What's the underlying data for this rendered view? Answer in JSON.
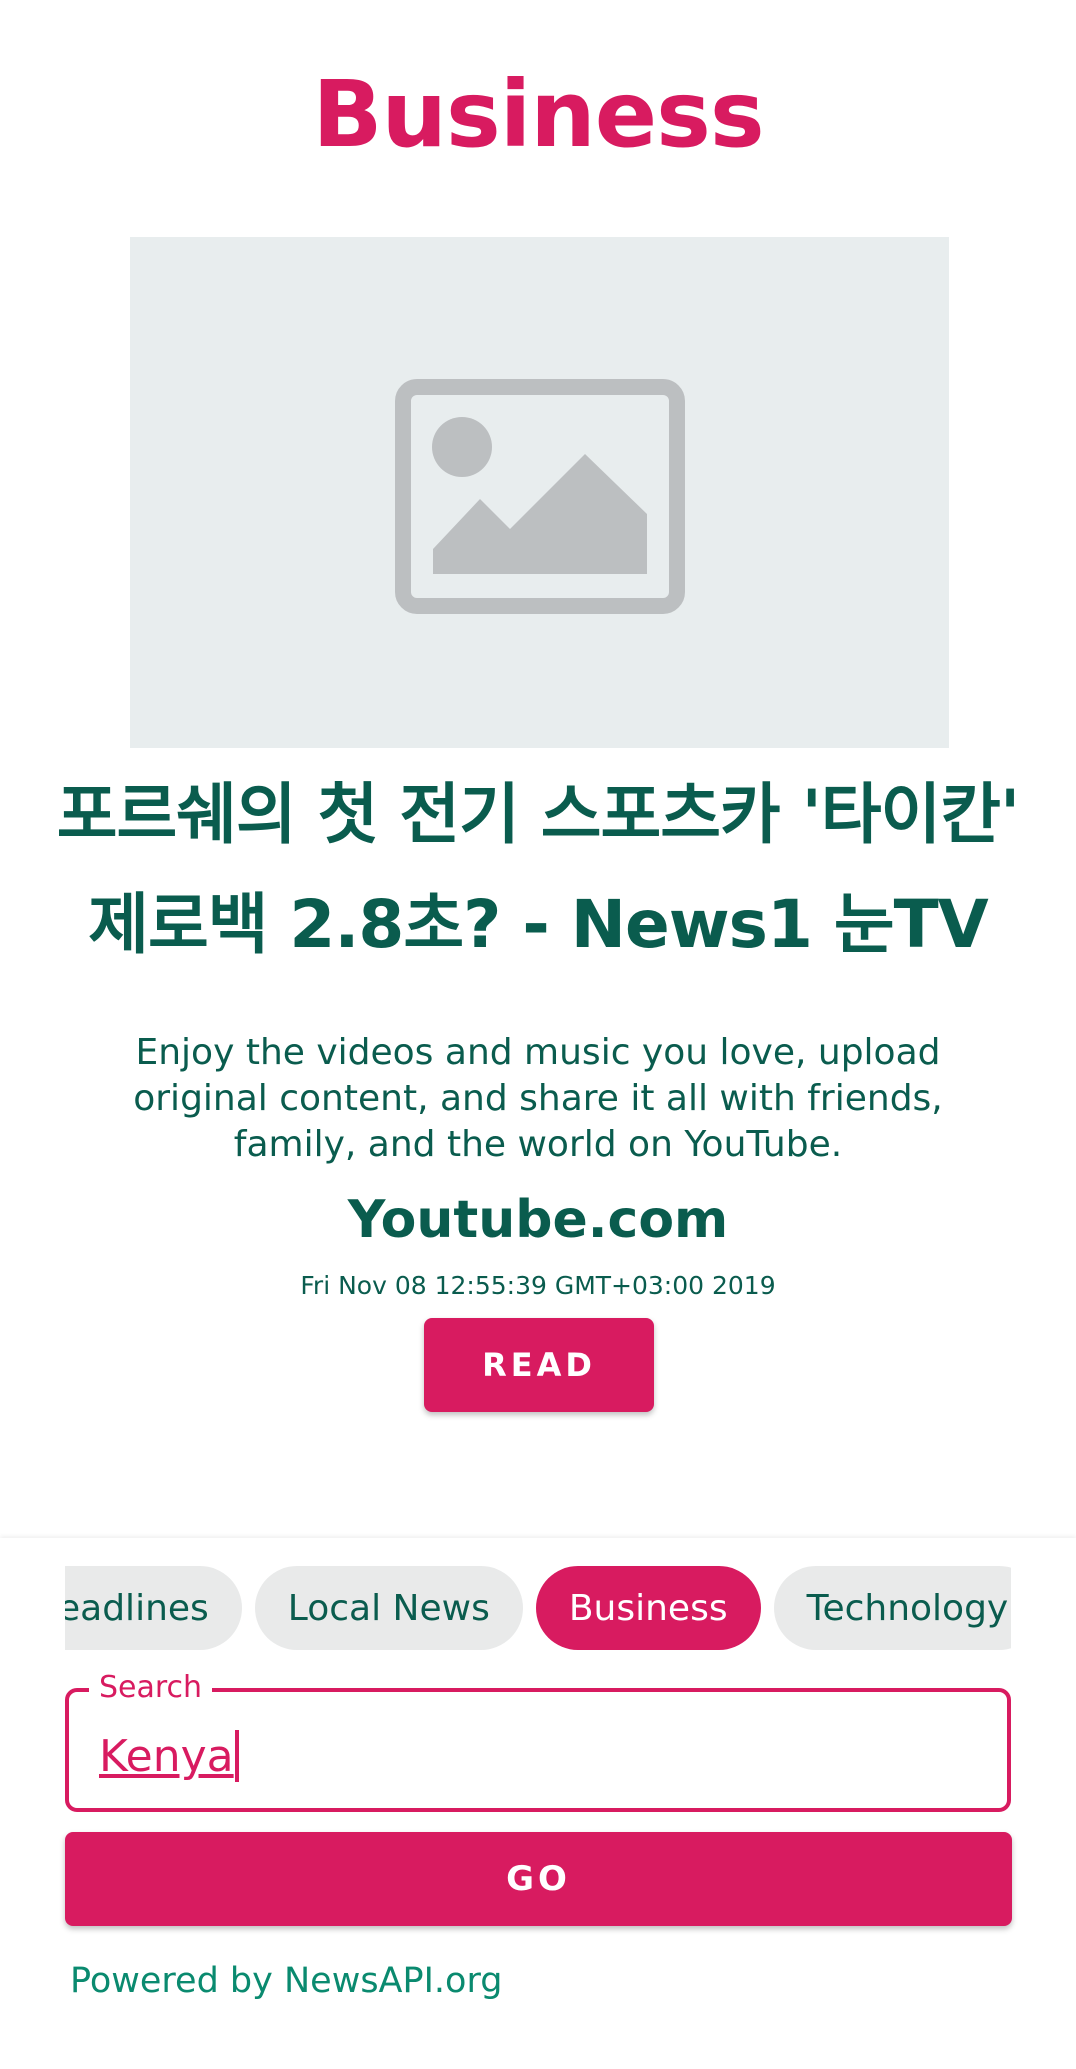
{
  "page": {
    "title": "Business"
  },
  "article": {
    "image_icon": "image-placeholder-icon",
    "headline": "포르쉐의 첫 전기 스포츠카 '타이칸' 제로백 2.8초? - News1 눈TV",
    "description": "Enjoy the videos and music you love, upload original content, and share it all with friends, family, and the world on YouTube.",
    "source": "Youtube.com",
    "published": "Fri Nov 08 12:55:39 GMT+03:00 2019",
    "read_label": "READ"
  },
  "categories": {
    "items": [
      {
        "label": "Headlines",
        "shown": "eadlines",
        "selected": false
      },
      {
        "label": "Local News",
        "selected": false
      },
      {
        "label": "Business",
        "selected": true
      },
      {
        "label": "Technology",
        "selected": false
      }
    ]
  },
  "search": {
    "label": "Search",
    "value": "Kenya"
  },
  "go_label": "GO",
  "footer": {
    "powered_by": "Powered by NewsAPI.org"
  },
  "colors": {
    "accent": "#d81b60",
    "text_primary": "#0a5c4e",
    "link": "#0a8a6f",
    "chip_bg": "#e9eaea",
    "placeholder_bg": "#e8edee"
  }
}
